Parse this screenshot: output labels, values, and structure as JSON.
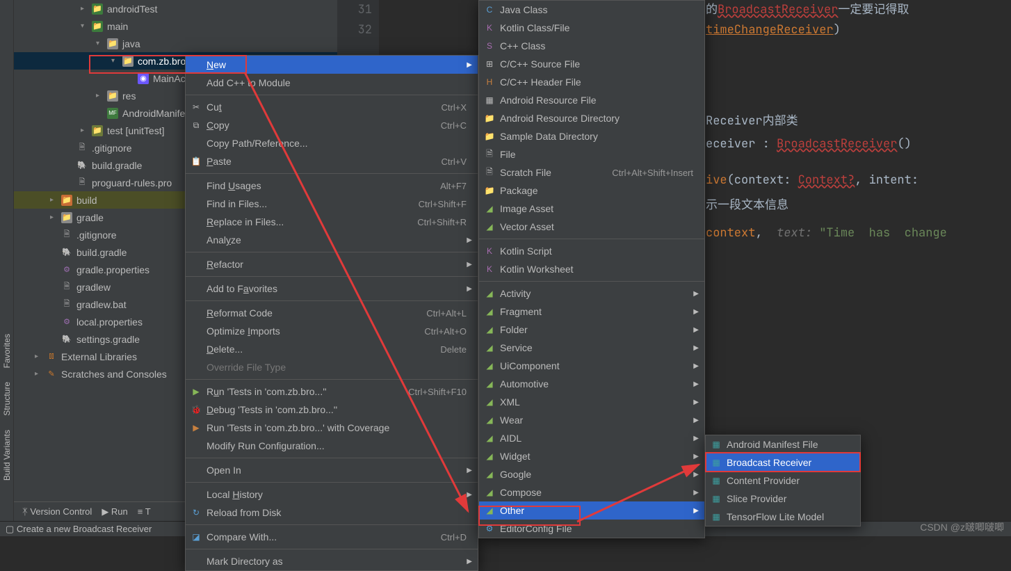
{
  "rail": [
    "Favorites",
    "Structure",
    "Build Variants"
  ],
  "tree": [
    {
      "indent": 3,
      "icon": "folder-src",
      "arrow": "right",
      "label": "androidTest"
    },
    {
      "indent": 3,
      "icon": "folder-src",
      "arrow": "down",
      "label": "main"
    },
    {
      "indent": 4,
      "icon": "folder",
      "arrow": "down",
      "label": "java"
    },
    {
      "indent": 5,
      "icon": "folder",
      "arrow": "down",
      "label": "com.zb.bro...",
      "selected": true
    },
    {
      "indent": 6,
      "icon": "kt",
      "label": "MainActi..."
    },
    {
      "indent": 4,
      "icon": "folder",
      "arrow": "right",
      "label": "res"
    },
    {
      "indent": 4,
      "icon": "mf",
      "label": "AndroidManife..."
    },
    {
      "indent": 3,
      "icon": "folder-test",
      "arrow": "right",
      "label": "test [unitTest]"
    },
    {
      "indent": 2,
      "icon": "file",
      "label": ".gitignore"
    },
    {
      "indent": 2,
      "icon": "gradle",
      "label": "build.gradle"
    },
    {
      "indent": 2,
      "icon": "file",
      "label": "proguard-rules.pro"
    },
    {
      "indent": 1,
      "icon": "folder-ex",
      "arrow": "right",
      "label": "build",
      "hl": true
    },
    {
      "indent": 1,
      "icon": "folder",
      "arrow": "right",
      "label": "gradle"
    },
    {
      "indent": 1,
      "icon": "file",
      "label": ".gitignore"
    },
    {
      "indent": 1,
      "icon": "gradle",
      "label": "build.gradle"
    },
    {
      "indent": 1,
      "icon": "prop",
      "label": "gradle.properties"
    },
    {
      "indent": 1,
      "icon": "file",
      "label": "gradlew"
    },
    {
      "indent": 1,
      "icon": "file",
      "label": "gradlew.bat"
    },
    {
      "indent": 1,
      "icon": "prop",
      "label": "local.properties"
    },
    {
      "indent": 1,
      "icon": "gradle",
      "label": "settings.gradle"
    },
    {
      "indent": 0,
      "icon": "lib",
      "arrow": "right",
      "label": "External Libraries"
    },
    {
      "indent": 0,
      "icon": "scr",
      "arrow": "right",
      "label": "Scratches and Consoles"
    }
  ],
  "status": {
    "version": "Version Control",
    "run": "Run",
    "todo": "T",
    "hint": "Create a new Broadcast Receiver",
    "watermark": "CSDN @z啵唧啵唧"
  },
  "gutter": [
    "31",
    "32"
  ],
  "code": {
    "l1": "的",
    "l1b": "BroadcastReceiver",
    "l1c": "一定要记得取",
    "l2a": "timeChangeReceiver",
    "l2b": ")",
    "l5": "Receiver内部类",
    "l6a": "eceiver : ",
    "l6b": "BroadcastReceiver",
    "l6c": "()",
    "l7a": "ive",
    "l7b": "(context: ",
    "l7c": "Context?",
    "l7d": ", intent:",
    "l8": "示一段文本信息",
    "l9a": "context",
    "l9b": ",  ",
    "l9p": "text: ",
    "l9s": "\"Time  has  change"
  },
  "menu1": [
    {
      "label": "New",
      "sel": true,
      "arrow": true,
      "ul": 0
    },
    {
      "label": "Add C++ to Module"
    },
    {
      "sep": true
    },
    {
      "label": "Cut",
      "shortcut": "Ctrl+X",
      "icon": "✂",
      "ul": 2
    },
    {
      "label": "Copy",
      "shortcut": "Ctrl+C",
      "icon": "⧉",
      "ul": 0
    },
    {
      "label": "Copy Path/Reference..."
    },
    {
      "label": "Paste",
      "shortcut": "Ctrl+V",
      "icon": "📋",
      "ul": 0
    },
    {
      "sep": true
    },
    {
      "label": "Find Usages",
      "shortcut": "Alt+F7",
      "ul": 5
    },
    {
      "label": "Find in Files...",
      "shortcut": "Ctrl+Shift+F"
    },
    {
      "label": "Replace in Files...",
      "shortcut": "Ctrl+Shift+R",
      "ul": 0
    },
    {
      "label": "Analyze",
      "arrow": true,
      "ul": 4
    },
    {
      "sep": true
    },
    {
      "label": "Refactor",
      "arrow": true,
      "ul": 0
    },
    {
      "sep": true
    },
    {
      "label": "Add to Favorites",
      "arrow": true,
      "ul": 8
    },
    {
      "sep": true
    },
    {
      "label": "Reformat Code",
      "shortcut": "Ctrl+Alt+L",
      "ul": 0
    },
    {
      "label": "Optimize Imports",
      "shortcut": "Ctrl+Alt+O",
      "ul": 9
    },
    {
      "label": "Delete...",
      "shortcut": "Delete",
      "ul": 0
    },
    {
      "label": "Override File Type",
      "disabled": true
    },
    {
      "sep": true
    },
    {
      "label": "Run 'Tests in 'com.zb.bro...''",
      "shortcut": "Ctrl+Shift+F10",
      "icon": "▶",
      "iclass": "ci-green",
      "ul": 1
    },
    {
      "label": "Debug 'Tests in 'com.zb.bro...''",
      "icon": "🐞",
      "iclass": "ci-green",
      "ul": 0
    },
    {
      "label": "Run 'Tests in 'com.zb.bro...' with Coverage",
      "icon": "▶",
      "iclass": "ci-orange"
    },
    {
      "label": "Modify Run Configuration..."
    },
    {
      "sep": true
    },
    {
      "label": "Open In",
      "arrow": true
    },
    {
      "sep": true
    },
    {
      "label": "Local History",
      "arrow": true,
      "ul": 6
    },
    {
      "label": "Reload from Disk",
      "icon": "↻",
      "iclass": "ci-blue"
    },
    {
      "sep": true
    },
    {
      "label": "Compare With...",
      "shortcut": "Ctrl+D",
      "icon": "◪",
      "iclass": "ci-blue"
    },
    {
      "sep": true
    },
    {
      "label": "Mark Directory as",
      "arrow": true
    }
  ],
  "menu2": [
    {
      "label": "Java Class",
      "icon": "C",
      "iclass": "ci-blue"
    },
    {
      "label": "Kotlin Class/File",
      "icon": "K",
      "iclass": "ci-purple"
    },
    {
      "label": "C++ Class",
      "icon": "S",
      "iclass": "ci-purple"
    },
    {
      "label": "C/C++ Source File",
      "icon": "⊞"
    },
    {
      "label": "C/C++ Header File",
      "icon": "H",
      "iclass": "ci-orange"
    },
    {
      "label": "Android Resource File",
      "icon": "▦"
    },
    {
      "label": "Android Resource Directory",
      "icon": "📁"
    },
    {
      "label": "Sample Data Directory",
      "icon": "📁"
    },
    {
      "label": "File",
      "icon": "🗎"
    },
    {
      "label": "Scratch File",
      "shortcut": "Ctrl+Alt+Shift+Insert",
      "icon": "🗎"
    },
    {
      "label": "Package",
      "icon": "📁"
    },
    {
      "label": "Image Asset",
      "icon": "◢",
      "iclass": "ci-green"
    },
    {
      "label": "Vector Asset",
      "icon": "◢",
      "iclass": "ci-green"
    },
    {
      "sep": true
    },
    {
      "label": "Kotlin Script",
      "icon": "K",
      "iclass": "ci-purple"
    },
    {
      "label": "Kotlin Worksheet",
      "icon": "K",
      "iclass": "ci-purple"
    },
    {
      "sep": true
    },
    {
      "label": "Activity",
      "icon": "◢",
      "iclass": "ci-green",
      "arrow": true
    },
    {
      "label": "Fragment",
      "icon": "◢",
      "iclass": "ci-green",
      "arrow": true
    },
    {
      "label": "Folder",
      "icon": "◢",
      "iclass": "ci-green",
      "arrow": true
    },
    {
      "label": "Service",
      "icon": "◢",
      "iclass": "ci-green",
      "arrow": true
    },
    {
      "label": "UiComponent",
      "icon": "◢",
      "iclass": "ci-green",
      "arrow": true
    },
    {
      "label": "Automotive",
      "icon": "◢",
      "iclass": "ci-green",
      "arrow": true
    },
    {
      "label": "XML",
      "icon": "◢",
      "iclass": "ci-green",
      "arrow": true
    },
    {
      "label": "Wear",
      "icon": "◢",
      "iclass": "ci-green",
      "arrow": true
    },
    {
      "label": "AIDL",
      "icon": "◢",
      "iclass": "ci-green",
      "arrow": true
    },
    {
      "label": "Widget",
      "icon": "◢",
      "iclass": "ci-green",
      "arrow": true
    },
    {
      "label": "Google",
      "icon": "◢",
      "iclass": "ci-green",
      "arrow": true
    },
    {
      "label": "Compose",
      "icon": "◢",
      "iclass": "ci-green",
      "arrow": true
    },
    {
      "label": "Other",
      "icon": "◢",
      "iclass": "ci-green",
      "arrow": true,
      "sel": true
    },
    {
      "label": "EditorConfig File",
      "icon": "⚙",
      "iclass": "ci-blue"
    }
  ],
  "menu3": [
    {
      "label": "Android Manifest File",
      "icon": "▦",
      "iclass": "ci-teal"
    },
    {
      "label": "Broadcast Receiver",
      "icon": "▦",
      "iclass": "ci-teal",
      "sel": true
    },
    {
      "label": "Content Provider",
      "icon": "▦",
      "iclass": "ci-teal"
    },
    {
      "label": "Slice Provider",
      "icon": "▦",
      "iclass": "ci-teal"
    },
    {
      "label": "TensorFlow Lite Model",
      "icon": "▦",
      "iclass": "ci-teal"
    }
  ]
}
